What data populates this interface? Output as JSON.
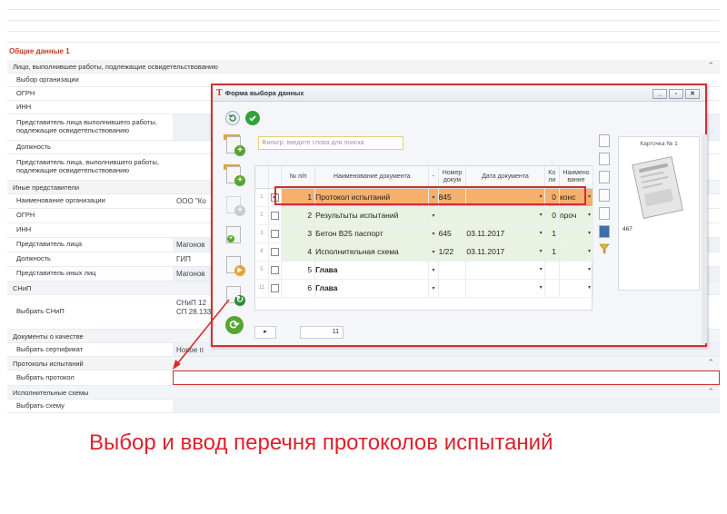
{
  "section_title": "Общие данные 1",
  "grid": {
    "cat1": "Лицо, выполнившее работы, подлежащие освидетельствованию",
    "org_choice": "Выбор организации",
    "ogrn": "ОГРН",
    "inn": "ИНН",
    "rep": "Представитель лица выполнившего работы, подлежащие освидетельствованию",
    "position": "Должность",
    "rep2": "Представитель лица, выполнившего работы, подлежащие освидетельствованию",
    "cat2": "Иные представители",
    "org_name": "Наименование организации",
    "org_name_val": "ООО \"Ко",
    "ogrn2": "ОГРН",
    "inn2": "ИНН",
    "rep_face": "Представитель лица",
    "rep_face_val": "Магонов",
    "position2": "Должность",
    "position2_val": "ГИП",
    "rep_other": "Представитель иных лиц",
    "rep_other_val": "Магонов",
    "cat3": "СНиП",
    "snip_choice": "Выбрать СНиП",
    "snip_val1": "СНиП 12",
    "snip_val2": "СП 28.133",
    "cat4": "Документы о качестве",
    "cert_choice": "Выбрать сертификат",
    "cert_val": "Новое п",
    "cat5": "Протоколы испытаний",
    "protocol_choice": "Выбрать протокол",
    "cat6": "Исполнительные схемы",
    "scheme_choice": "Выбрать схему"
  },
  "dialog": {
    "title": "Форма выбора данных",
    "filter_placeholder": "Фильтр: введите слова для поиска",
    "columns": [
      "№ п/п",
      "Наименование документа",
      "-",
      "Номер докум",
      "Дата документа",
      "Ко ли",
      "Наимено вание"
    ],
    "rows": [
      {
        "rn": "1",
        "checked": true,
        "n": "1",
        "name": "Протокол испытаний",
        "num": "845",
        "date": "",
        "qty": "0",
        "unit": "конс"
      },
      {
        "rn": "2",
        "checked": false,
        "n": "2",
        "name": "Результыты испытаний",
        "num": "",
        "date": "",
        "qty": "0",
        "unit": "проч"
      },
      {
        "rn": "3",
        "checked": false,
        "n": "3",
        "name": "Бетон В25 паспорт",
        "num": "645",
        "date": "03.11.2017",
        "qty": "1",
        "unit": ""
      },
      {
        "rn": "4",
        "checked": false,
        "n": "4",
        "name": "Исполнительная схема",
        "num": "1/22",
        "date": "03.11.2017",
        "qty": "1",
        "unit": ""
      },
      {
        "rn": "5",
        "checked": false,
        "n": "5",
        "name": "Глава",
        "num": "",
        "date": "",
        "qty": "",
        "unit": ""
      },
      {
        "rn": "11",
        "checked": false,
        "n": "6",
        "name": "Глава",
        "num": "",
        "date": "",
        "qty": "",
        "unit": ""
      }
    ],
    "pager_page": "",
    "pager_count": "11",
    "card_title": "Карточка № 1",
    "card_number": "467"
  },
  "caption": "Выбор и ввод перечня протоколов испытаний",
  "colors": {
    "accent_red": "#d32f2f",
    "selected_row": "#f5b06e",
    "doc_row": "#eaf3e2"
  }
}
